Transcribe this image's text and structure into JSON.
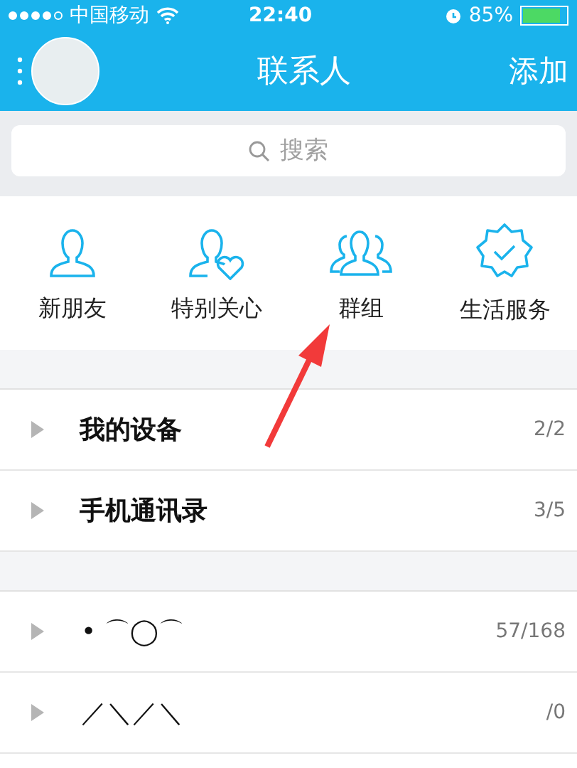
{
  "status_bar": {
    "carrier": "中国移动",
    "time": "22:40",
    "battery": "85%"
  },
  "nav": {
    "title": "联系人",
    "action": "添加"
  },
  "search": {
    "placeholder": "搜索"
  },
  "shortcuts": [
    {
      "kind": "person",
      "label": "新朋友"
    },
    {
      "kind": "heart",
      "label": "特别关心"
    },
    {
      "kind": "group",
      "label": "群组"
    },
    {
      "kind": "badge",
      "label": "生活服务"
    }
  ],
  "sections": [
    [
      {
        "name": "我的设备",
        "count": "2/2",
        "bold": true
      },
      {
        "name": "手机通讯录",
        "count": "3/5",
        "bold": true
      }
    ],
    [
      {
        "name": "•  ⌒◯⌒",
        "count": "57/168",
        "bold": false
      },
      {
        "name": "／＼／＼",
        "count": "/0",
        "bold": false
      }
    ]
  ]
}
